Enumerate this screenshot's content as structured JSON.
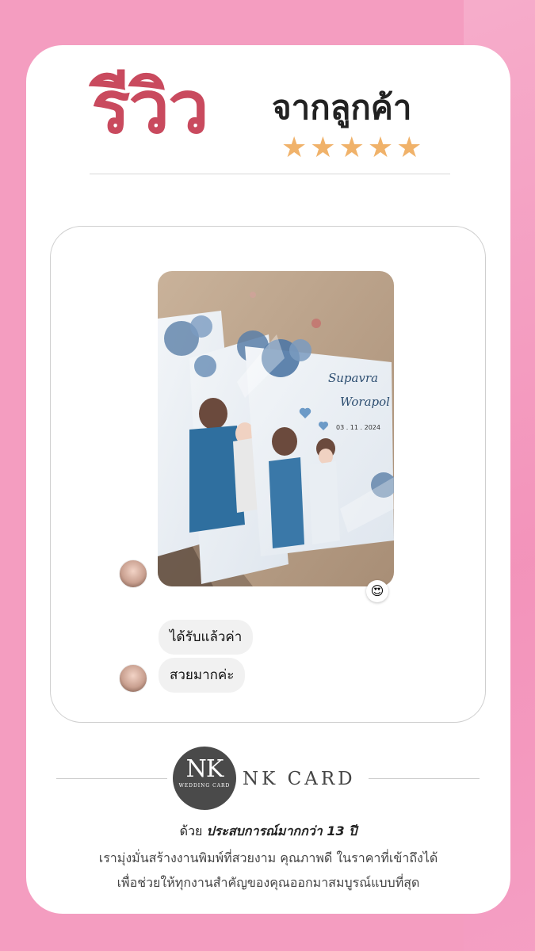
{
  "header": {
    "title_main": "รีวิว",
    "title_sub": "จากลูกค้า",
    "stars": [
      "★",
      "★",
      "★",
      "★",
      "★"
    ],
    "rating": 5
  },
  "chat": {
    "reaction_emoji": "😍",
    "messages": [
      {
        "text": "ได้รับแล้วค่า"
      },
      {
        "text": "สวยมากค่ะ"
      }
    ]
  },
  "brand": {
    "logo_letters": "NK",
    "logo_small": "WEDDING CARD",
    "name": "NK CARD"
  },
  "footer": {
    "line1_prefix": "ด้วย",
    "line1_bold": "ประสบการณ์มากกว่า 13 ปี",
    "line2": "เรามุ่งมั่นสร้างงานพิมพ์ที่สวยงาม คุณภาพดี ในราคาที่เข้าถึงได้",
    "line3": "เพื่อช่วยให้ทุกงานสำคัญของคุณออกมาสมบูรณ์แบบที่สุด"
  },
  "colors": {
    "background_pink": "#f49dc0",
    "title_red": "#c94a5e",
    "star_gold": "#f0b26a"
  },
  "photo": {
    "card_names": [
      "Supavra",
      "Worapol"
    ],
    "card_date": "03 . 11 . 2024"
  }
}
